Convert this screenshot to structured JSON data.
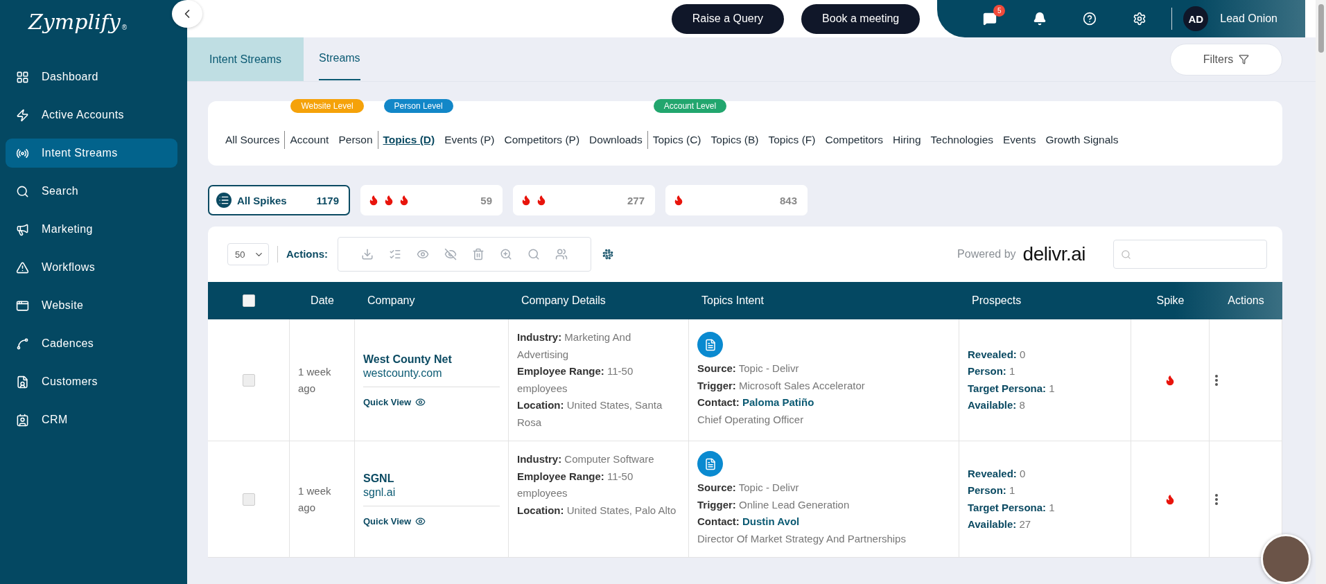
{
  "brand": {
    "name": "Zymplify",
    "mark": "®"
  },
  "sidebar": {
    "items": [
      {
        "label": "Dashboard",
        "selected": false
      },
      {
        "label": "Active Accounts",
        "selected": false
      },
      {
        "label": "Intent Streams",
        "selected": true
      },
      {
        "label": "Search",
        "selected": false
      },
      {
        "label": "Marketing",
        "selected": false
      },
      {
        "label": "Workflows",
        "selected": false
      },
      {
        "label": "Website",
        "selected": false
      },
      {
        "label": "Cadences",
        "selected": false
      },
      {
        "label": "Customers",
        "selected": false
      },
      {
        "label": "CRM",
        "selected": false
      }
    ]
  },
  "topbar": {
    "buttons": [
      "Raise a Query",
      "Book a meeting"
    ],
    "chat_badge": "5",
    "user_initials": "AD",
    "user_name": "Lead Onion"
  },
  "tabs": [
    {
      "label": "Intent Streams",
      "selected": false
    },
    {
      "label": "Streams",
      "selected": true
    }
  ],
  "filters_button": "Filters",
  "sources": [
    {
      "items": [
        {
          "label": "All Sources",
          "selected": false
        }
      ]
    },
    {
      "badge": "Website Level",
      "color": "#f5a20a",
      "items": [
        {
          "label": "Account",
          "selected": false
        },
        {
          "label": "Person",
          "selected": false
        }
      ]
    },
    {
      "badge": "Person Level",
      "color": "#1287c8",
      "items": [
        {
          "label": "Topics (D)",
          "selected": true
        },
        {
          "label": "Events (P)",
          "selected": false
        },
        {
          "label": "Competitors (P)",
          "selected": false
        },
        {
          "label": "Downloads",
          "selected": false
        }
      ]
    },
    {
      "badge": "Account Level",
      "color": "#22a66e",
      "items": [
        {
          "label": "Topics (C)",
          "selected": false
        },
        {
          "label": "Topics (B)",
          "selected": false
        },
        {
          "label": "Topics (F)",
          "selected": false
        },
        {
          "label": "Competitors",
          "selected": false
        },
        {
          "label": "Hiring",
          "selected": false
        },
        {
          "label": "Technologies",
          "selected": false
        },
        {
          "label": "Events",
          "selected": false
        },
        {
          "label": "Growth Signals",
          "selected": false
        }
      ]
    }
  ],
  "spike_filters": [
    {
      "kind": "all",
      "label": "All Spikes",
      "count": "1179",
      "selected": true
    },
    {
      "kind": "high",
      "count": "59",
      "selected": false
    },
    {
      "kind": "medium",
      "count": "277",
      "selected": false
    },
    {
      "kind": "low",
      "count": "843",
      "selected": false
    }
  ],
  "toolbar": {
    "page_size": "50",
    "actions_label": "Actions:",
    "powered_by": "Powered by",
    "provider": "delivr.ai"
  },
  "table": {
    "columns": [
      "Date",
      "Company",
      "Company Details",
      "Topics Intent",
      "Prospects",
      "Spike",
      "Actions"
    ],
    "all_checked": false,
    "rows": [
      {
        "checked": false,
        "date": "1 week ago",
        "company": "West County Net",
        "domain": "westcounty.com",
        "quick_view": "Quick View",
        "details": [
          {
            "label": "Industry:",
            "value": "Marketing And Advertising"
          },
          {
            "label": "Employee Range:",
            "value": "11-50 employees"
          },
          {
            "label": "Location:",
            "value": "United States, Santa Rosa"
          }
        ],
        "intent": {
          "source_label": "Source:",
          "source": "Topic - Delivr",
          "trigger_label": "Trigger:",
          "trigger": "Microsoft Sales Accelerator",
          "contact_label": "Contact:",
          "contact": "Paloma Patiño",
          "title": "Chief Operating Officer"
        },
        "prospects": [
          {
            "label": "Revealed:",
            "value": "0"
          },
          {
            "label": "Person:",
            "value": "1"
          },
          {
            "label": "Target Persona:",
            "value": "1"
          },
          {
            "label": "Available:",
            "value": "8"
          }
        ],
        "kind": "low"
      },
      {
        "checked": false,
        "date": "1 week ago",
        "company": "SGNL",
        "domain": "sgnl.ai",
        "quick_view": "Quick View",
        "details": [
          {
            "label": "Industry:",
            "value": "Computer Software"
          },
          {
            "label": "Employee Range:",
            "value": "11-50 employees"
          },
          {
            "label": "Location:",
            "value": "United States, Palo Alto"
          }
        ],
        "intent": {
          "source_label": "Source:",
          "source": "Topic - Delivr",
          "trigger_label": "Trigger:",
          "trigger": "Online Lead Generation",
          "contact_label": "Contact:",
          "contact": "Dustin Avol",
          "title": "Director Of Market Strategy And Partnerships"
        },
        "prospects": [
          {
            "label": "Revealed:",
            "value": "0"
          },
          {
            "label": "Person:",
            "value": "1"
          },
          {
            "label": "Target Persona:",
            "value": "1"
          },
          {
            "label": "Available:",
            "value": "27"
          }
        ],
        "kind": "low"
      }
    ]
  }
}
